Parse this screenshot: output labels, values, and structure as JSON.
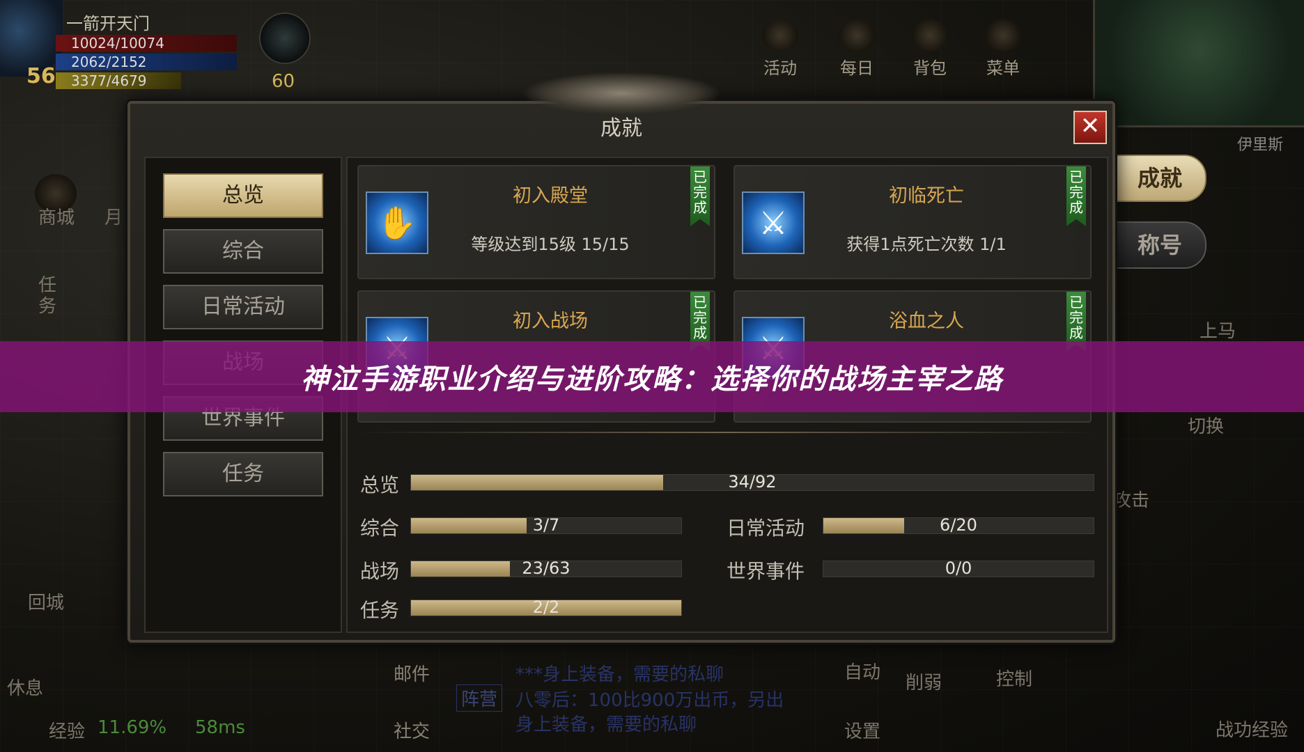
{
  "hud": {
    "player_name": "一箭开天门",
    "hp": "10024/10074",
    "mp": "2062/2152",
    "exp": "3377/4679",
    "level": "56",
    "pet_level": "60"
  },
  "top_icons": [
    {
      "label": "活动",
      "icon": "activity-icon"
    },
    {
      "label": "每日",
      "icon": "daily-icon"
    },
    {
      "label": "背包",
      "icon": "bag-icon"
    },
    {
      "label": "菜单",
      "icon": "menu-icon"
    }
  ],
  "minimap": {
    "label": "伊里斯"
  },
  "left_side": {
    "shop": "商城",
    "month": "月",
    "quest": "任务",
    "return_city": "回城",
    "rest": "休息",
    "exp": "经验",
    "exp_value": "11.69%",
    "latency": "58ms"
  },
  "right_side": {
    "mount": "上马",
    "switch": "切换",
    "attack": "攻击",
    "control": "控制",
    "battle_exp": "战功经验",
    "auto": "自动",
    "weaken": "削弱",
    "settings": "设置"
  },
  "chat": {
    "tag": "阵营",
    "lines": [
      "八零后：100比900万出币，另出",
      "***身上装备，需要的私聊",
      "八零后：100比900万出币，另出",
      "身上装备，需要的私聊"
    ]
  },
  "bottom": {
    "mail": "邮件",
    "social": "社交"
  },
  "right_tabs": {
    "achievement": "成就",
    "title": "称号"
  },
  "dialog": {
    "title": "成就",
    "nav": [
      "总览",
      "综合",
      "日常活动",
      "战场",
      "世界事件",
      "任务"
    ],
    "achievements": [
      {
        "title": "初入殿堂",
        "desc": "等级达到15级  15/15",
        "badge": "已完成"
      },
      {
        "title": "初临死亡",
        "desc": "获得1点死亡次数  1/1",
        "badge": "已完成"
      },
      {
        "title": "初入战场",
        "desc": "",
        "badge": "已完成"
      },
      {
        "title": "浴血之人",
        "desc": "",
        "badge": "已完成"
      }
    ],
    "stats": [
      {
        "label": "总览",
        "text": "34/92",
        "progress": 0.3696
      },
      {
        "label": "综合",
        "text": "3/7",
        "progress": 0.4286
      },
      {
        "label": "日常活动",
        "text": "6/20",
        "progress": 0.3
      },
      {
        "label": "战场",
        "text": "23/63",
        "progress": 0.3651
      },
      {
        "label": "世界事件",
        "text": "0/0",
        "progress": 0
      },
      {
        "label": "任务",
        "text": "2/2",
        "progress": 1.0
      }
    ]
  },
  "banner": {
    "text": "神泣手游职业介绍与进阶攻略：选择你的战场主宰之路"
  },
  "colors": {
    "accent_gold": "#d8a752",
    "banner_purple": "#86147a",
    "badge_green": "#3c8a3c",
    "close_red": "#c2352a"
  }
}
